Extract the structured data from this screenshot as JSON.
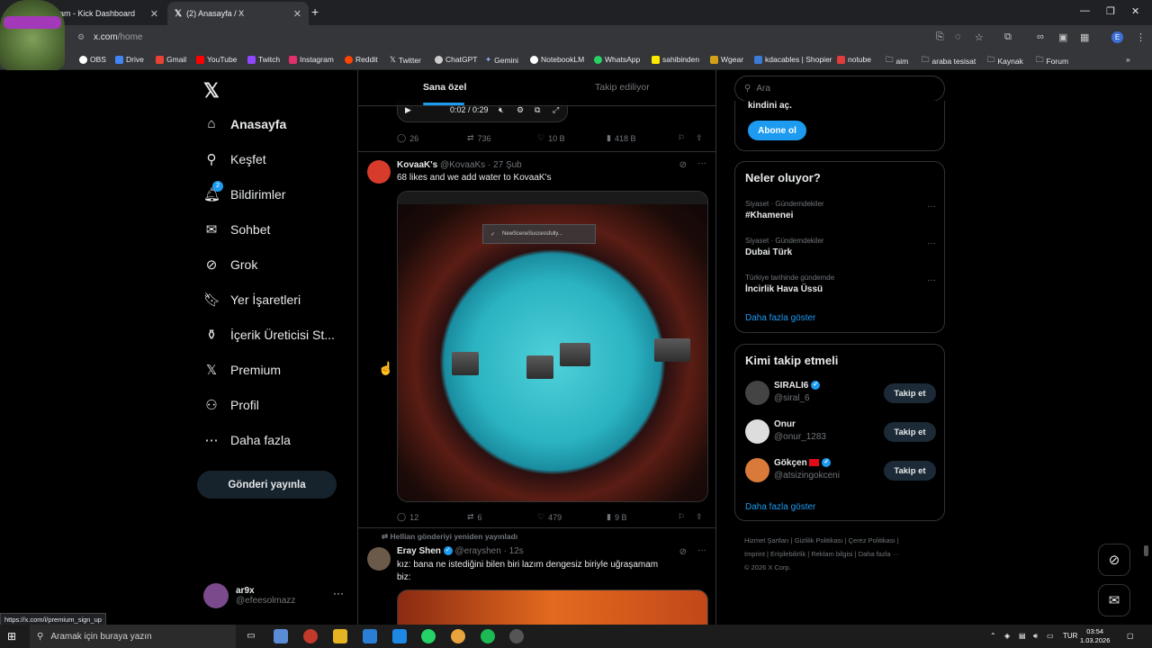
{
  "browser": {
    "tabs": [
      {
        "title": "am - Kick Dashboard",
        "close": "✕"
      },
      {
        "title": "(2) Anasayfa / X",
        "close": "✕"
      }
    ],
    "new_tab": "+",
    "window_controls": [
      "—",
      "❐",
      "✕"
    ],
    "url_host": "x.com",
    "url_path": "/home",
    "bookmarks": [
      {
        "label": "n",
        "color": "#888"
      },
      {
        "label": "OBS",
        "color": "#ffffff"
      },
      {
        "label": "Drive",
        "color": "#4285f4"
      },
      {
        "label": "Gmail",
        "color": "#ea4335"
      },
      {
        "label": "YouTube",
        "color": "#ff0000"
      },
      {
        "label": "Twitch",
        "color": "#9146ff"
      },
      {
        "label": "Instagram",
        "color": "#e1306c"
      },
      {
        "label": "Reddit",
        "color": "#ff4500"
      },
      {
        "label": "Twitter",
        "color": "#ffffff"
      },
      {
        "label": "ChatGPT",
        "color": "#cccccc"
      },
      {
        "label": "Gemini",
        "color": "#8ab4f8"
      },
      {
        "label": "NotebookLM",
        "color": "#ffffff"
      },
      {
        "label": "WhatsApp",
        "color": "#25d366"
      },
      {
        "label": "sahibinden",
        "color": "#ffe800"
      },
      {
        "label": "Wgear",
        "color": "#d4a017"
      },
      {
        "label": "kdacables | Shopier",
        "color": "#3a7bd5"
      },
      {
        "label": "notube",
        "color": "#e03c3c"
      },
      {
        "label": "aim",
        "color": "#e8eaed"
      },
      {
        "label": "araba tesisat",
        "color": "#e8eaed"
      },
      {
        "label": "Kaynak",
        "color": "#e8eaed"
      },
      {
        "label": "Forum",
        "color": "#e8eaed"
      }
    ],
    "bookmarks_more": "»",
    "status_url": "https://x.com/i/premium_sign_up"
  },
  "sidebar": {
    "logo": "𝕏",
    "items": [
      {
        "label": "Anasayfa",
        "icon": "⌂"
      },
      {
        "label": "Keşfet",
        "icon": "⚲"
      },
      {
        "label": "Bildirimler",
        "icon": "🔔︎",
        "badge": "2"
      },
      {
        "label": "Sohbet",
        "icon": "✉"
      },
      {
        "label": "Grok",
        "icon": "⊘"
      },
      {
        "label": "Yer İşaretleri",
        "icon": "🔖︎"
      },
      {
        "label": "İçerik Üreticisi St...",
        "icon": "⚱"
      },
      {
        "label": "Premium",
        "icon": "𝕏"
      },
      {
        "label": "Profil",
        "icon": "⚇"
      },
      {
        "label": "Daha fazla",
        "icon": "⋯"
      }
    ],
    "post_button": "Gönderi yayınla",
    "account": {
      "name": "ar9x",
      "handle": "@efeesolmazz",
      "more": "···"
    }
  },
  "feed": {
    "tabs": [
      "Sana özel",
      "Takip ediliyor"
    ],
    "media_strip": {
      "time": "0:02 / 0:29"
    },
    "top_post_actions": {
      "replies": "26",
      "reposts": "736",
      "likes": "10 B",
      "views": "418 B"
    },
    "post1": {
      "name": "KovaaK's",
      "handle": "@KovaaKs",
      "date": "· 27 Şub",
      "text": "68 likes and we add water to KovaaK's",
      "image_notice": "NewSceneSuccessfully...",
      "actions": {
        "replies": "12",
        "reposts": "6",
        "likes": "479",
        "views": "9 B"
      }
    },
    "post2": {
      "repost_note": "Hellian gönderiyi yeniden yayınladı",
      "name": "Eray Shen",
      "handle": "@erayshen",
      "date": "· 12s",
      "text_line1": "kız: bana ne istediğini bilen biri lazım dengesiz biriyle uğraşamam",
      "text_line2": "biz:"
    }
  },
  "right": {
    "search_placeholder": "Ara",
    "premium_fragment": "kindini aç.",
    "subscribe_button": "Abone ol",
    "trends_title": "Neler oluyor?",
    "trends": [
      {
        "category": "Siyaset · Gündemdekiler",
        "title": "#Khamenei"
      },
      {
        "category": "Siyaset · Gündemdekiler",
        "title": "Dubai Türk"
      },
      {
        "category": "Türkiye tarihinde gündemde",
        "title": "İncirlik Hava Üssü"
      }
    ],
    "trends_more": "Daha fazla göster",
    "who_title": "Kimi takip etmeli",
    "who": [
      {
        "name": "SIRALI6",
        "handle": "@siral_6",
        "button": "Takip et",
        "color": "#444"
      },
      {
        "name": "Onur",
        "handle": "@onur_1283",
        "button": "Takip et",
        "color": "#ddd"
      },
      {
        "name": "Gökçen",
        "handle": "@atsizingokceni",
        "button": "Takip et",
        "color": "#d97a3a"
      }
    ],
    "who_more": "Daha fazla göster",
    "footer_line1": "Hizmet Şartları  |  Gizlilik Politikası  |  Çerez Politikası  |",
    "footer_line2": "Imprint  |  Erişilebilirlik  |  Reklam bilgisi  |  Daha fazla ···",
    "footer_line3": "© 2026 X Corp."
  },
  "taskbar": {
    "search_placeholder": "Aramak için buraya yazın",
    "lang": "TUR",
    "time": "03:54",
    "date": "1.03.2026"
  }
}
